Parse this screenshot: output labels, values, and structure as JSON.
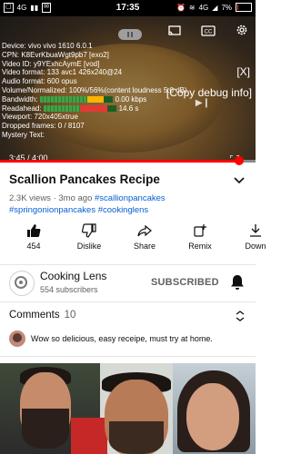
{
  "status_bar": {
    "time": "17:35",
    "network": "4G",
    "battery": "7%",
    "battery_level": 0.07
  },
  "debug": {
    "device": "Device: vivo vivo 1610 6.0.1",
    "cpn": "CPN: K8EvrKbuaWgt9pb7 [exo2]",
    "video_id": "Video ID: y9YExhcAymE [vod]",
    "video_format": "Video format: 133 avc1 426x240@24",
    "audio_format": "Audio format: 600 opus",
    "volume": "Volume/Normalized: 100%/56%(content loudness 5.0 dB)",
    "bandwidth_label": "Bandwidth:",
    "bandwidth_value": "0.00 kbps",
    "readahead_label": "Readahead:",
    "readahead_value": "14.6 s",
    "viewport": "Viewport: 720x405xtrue",
    "dropped": "Dropped frames: 0 / 8107",
    "mystery": "Mystery Text:",
    "close": "[X]",
    "copy": "[Copy debug info]"
  },
  "player": {
    "current_time": "3:45",
    "duration": "4:00",
    "time_display": "3:45 / 4:00",
    "progress": 0.9375,
    "accent": "#ff0000"
  },
  "video": {
    "title": "Scallion Pancakes Recipe",
    "views": "2.3K views",
    "age": "3mo ago",
    "tags": [
      "#scallionpancakes",
      "#springonionpancakes",
      "#cookinglens"
    ]
  },
  "actions": [
    {
      "label": "454",
      "icon": "thumbs-up-icon"
    },
    {
      "label": "Dislike",
      "icon": "thumbs-down-icon"
    },
    {
      "label": "Share",
      "icon": "share-icon"
    },
    {
      "label": "Remix",
      "icon": "remix-icon"
    },
    {
      "label": "Down",
      "icon": "download-icon"
    }
  ],
  "channel": {
    "name": "Cooking Lens",
    "subscribers": "554 subscribers",
    "subscribe_label": "SUBSCRIBED"
  },
  "comments": {
    "heading": "Comments",
    "count": "10",
    "top_comment": "Wow so delicious, easy receipe, must try at home."
  }
}
